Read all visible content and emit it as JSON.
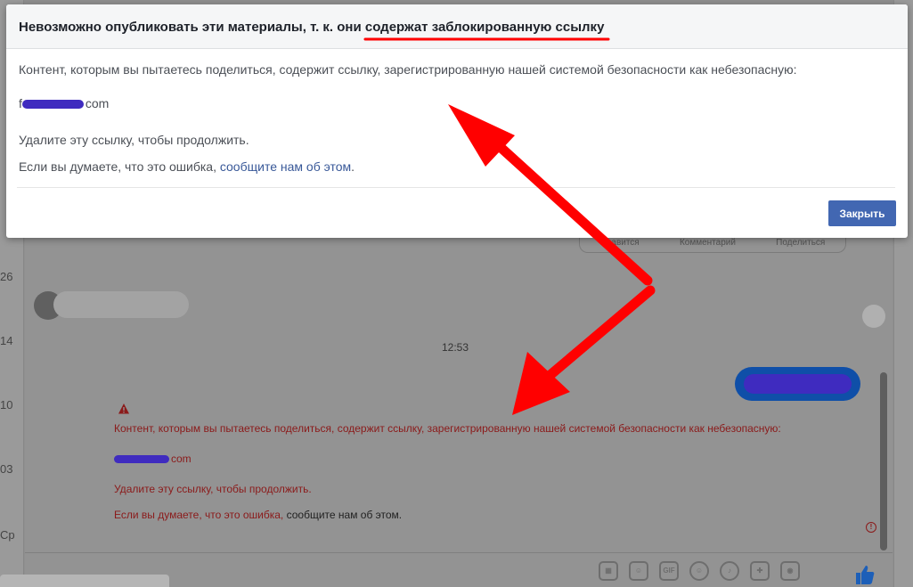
{
  "modal": {
    "title": "Невозможно опубликовать эти материалы, т. к. они содержат заблокированную ссылку",
    "message": "Контент, которым вы пытаетесь поделиться, содержит ссылку, зарегистрированную нашей системой безопасности как небезопасную:",
    "link_prefix": "f",
    "link_suffix": "com",
    "remove_text": "Удалите эту ссылку, чтобы продолжить.",
    "error_text": "Если вы думаете, что это ошибка, ",
    "report_link": "сообщите нам об этом",
    "report_end": ".",
    "close_label": "Закрыть",
    "close_color": "#4267b2"
  },
  "chat": {
    "timestamp": "12:53",
    "error": {
      "message": "Контент, которым вы пытаетесь поделиться, содержит ссылку, зарегистрированную нашей системой безопасности как небезопасную:",
      "link_suffix": "com",
      "remove_text": "Удалите эту ссылку, чтобы продолжить.",
      "error_text": "Если вы думаете, что это ошибка, ",
      "report_text": "сообщите нам об этом.",
      "color": "#8b1a1a"
    },
    "post_actions": [
      "Нравится",
      "Комментарий",
      "Поделиться"
    ],
    "composer_icons": [
      "image-icon",
      "sticker-icon",
      "gif-icon",
      "emoji-icon",
      "microphone-icon",
      "gamepad-icon",
      "camera-icon",
      "thumbs-up-icon"
    ],
    "composer_gif_label": "GIF"
  },
  "left_strip": {
    "labels": [
      "26",
      "14",
      "10",
      "03",
      "Ср"
    ]
  },
  "annotation": {
    "arrow_color": "#ff0000",
    "underline_color": "#ff0000"
  }
}
